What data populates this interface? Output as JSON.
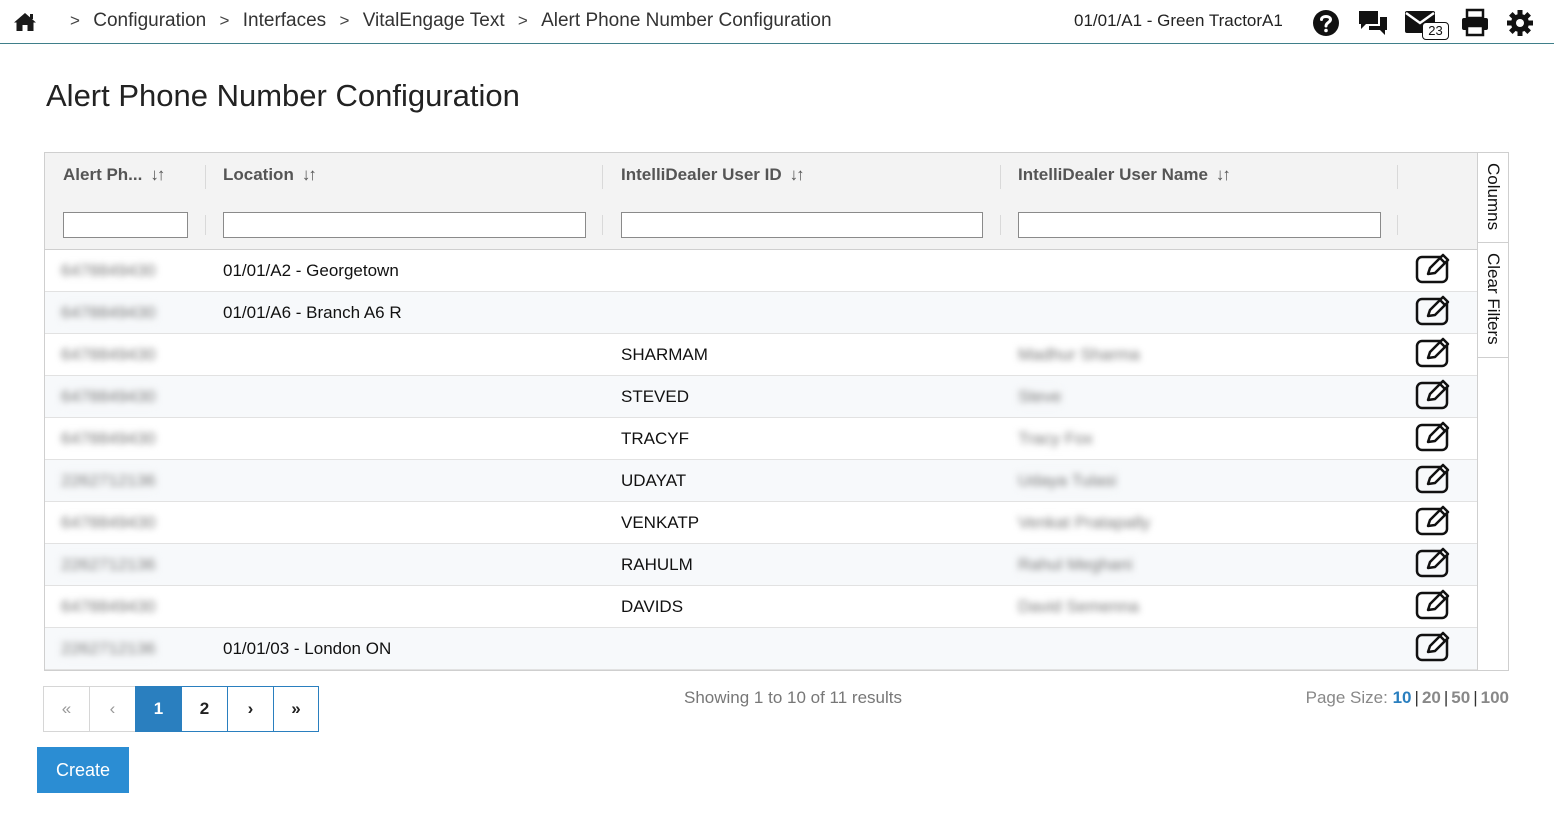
{
  "header": {
    "breadcrumbs": [
      "Configuration",
      "Interfaces",
      "VitalEngage Text",
      "Alert Phone Number Configuration"
    ],
    "breadcrumb_separator": ">",
    "store": "01/01/A1 - Green TractorA1",
    "mail_count": "23",
    "icons": [
      "home-icon",
      "help-icon",
      "chat-icon",
      "mail-icon",
      "print-icon",
      "gear-icon"
    ]
  },
  "page": {
    "title": "Alert Phone Number Configuration"
  },
  "grid": {
    "columns": [
      "Alert Ph...",
      "Location",
      "IntelliDealer User ID",
      "IntelliDealer User Name"
    ],
    "sort_glyph": "↓↑",
    "filters": [
      "",
      "",
      "",
      ""
    ],
    "rows": [
      {
        "phone": "6478849430",
        "location": "01/01/A2 - Georgetown",
        "user_id": "",
        "user_name": ""
      },
      {
        "phone": "6478849430",
        "location": "01/01/A6 - Branch A6 R",
        "user_id": "",
        "user_name": ""
      },
      {
        "phone": "6478849430",
        "location": "",
        "user_id": "SHARMAM",
        "user_name": "Madhur Sharma"
      },
      {
        "phone": "6478849430",
        "location": "",
        "user_id": "STEVED",
        "user_name": "Steve"
      },
      {
        "phone": "6478849430",
        "location": "",
        "user_id": "TRACYF",
        "user_name": "Tracy Fox"
      },
      {
        "phone": "2262712136",
        "location": "",
        "user_id": "UDAYAT",
        "user_name": "Udaya Tulasi"
      },
      {
        "phone": "6478849430",
        "location": "",
        "user_id": "VENKATP",
        "user_name": "Venkat Pratapally"
      },
      {
        "phone": "2262712136",
        "location": "",
        "user_id": "RAHULM",
        "user_name": "Rahul Meghani"
      },
      {
        "phone": "6478849430",
        "location": "",
        "user_id": "DAVIDS",
        "user_name": "David Semenna"
      },
      {
        "phone": "2262712136",
        "location": "01/01/03 - London ON",
        "user_id": "",
        "user_name": ""
      }
    ]
  },
  "side_tabs": [
    "Columns",
    "Clear Filters"
  ],
  "pagination": {
    "first": "«",
    "prev": "‹",
    "pages": [
      "1",
      "2"
    ],
    "next": "›",
    "last": "»",
    "current_page": "1",
    "summary": "Showing 1 to 10 of 11 results",
    "page_size_label": "Page Size:",
    "page_sizes": [
      "10",
      "20",
      "50",
      "100"
    ],
    "selected_size": "10"
  },
  "actions": {
    "create_label": "Create"
  },
  "colors": {
    "accent": "#2a7fbf",
    "button": "#2b8dd3",
    "header_rule": "#3f7f8a"
  }
}
